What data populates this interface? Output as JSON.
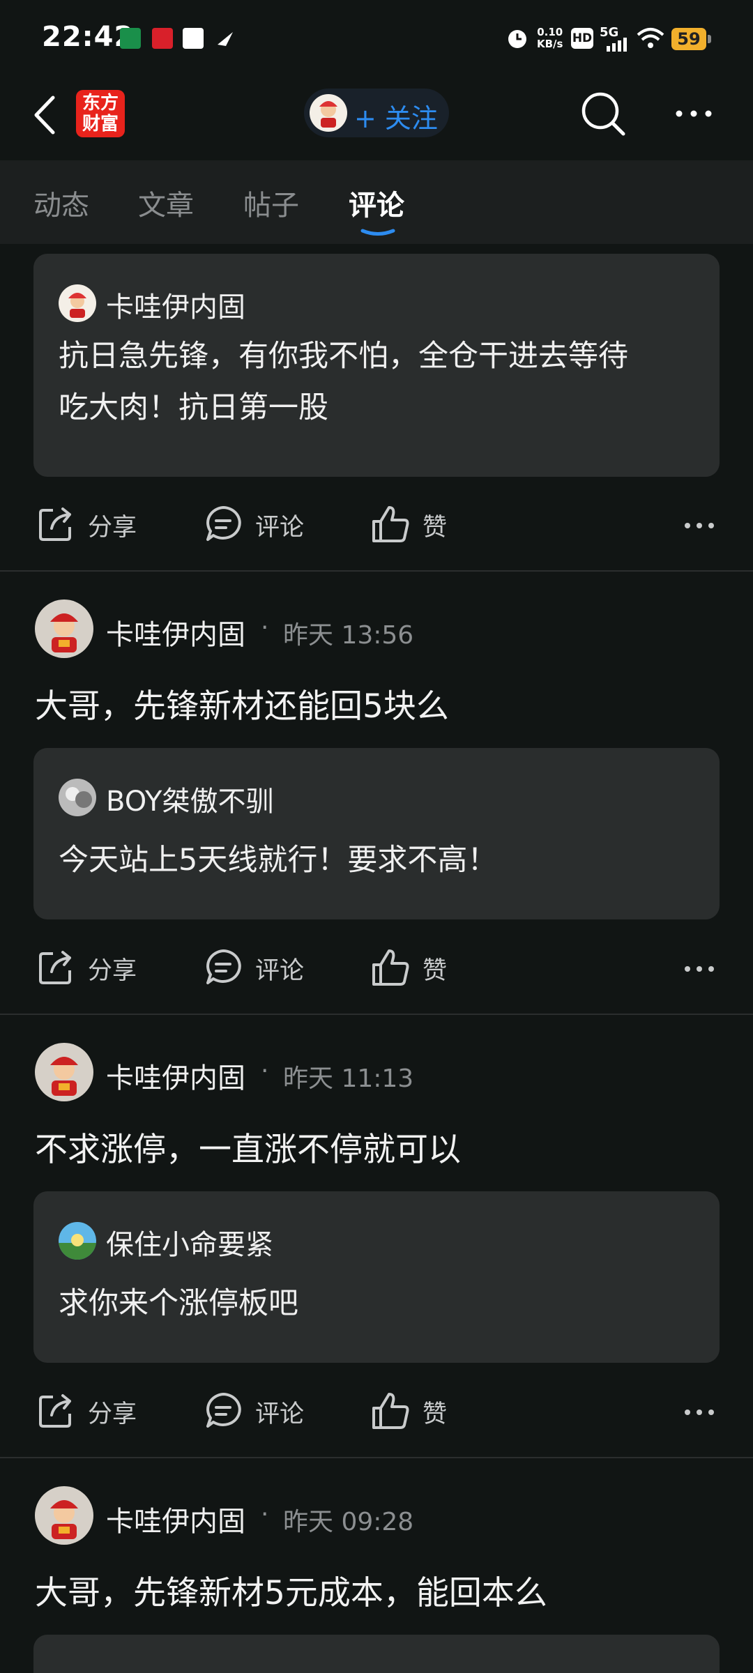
{
  "status_bar": {
    "time": "22:42",
    "net_speed_value": "0.10",
    "net_speed_unit": "KB/s",
    "hd": "HD",
    "network": "5G",
    "battery": "59"
  },
  "header": {
    "logo_line1": "东方",
    "logo_line2": "财富",
    "follow_label": "+ 关注"
  },
  "tabs": [
    {
      "label": "动态"
    },
    {
      "label": "文章"
    },
    {
      "label": "帖子"
    },
    {
      "label": "评论",
      "active": true
    }
  ],
  "actions": {
    "share": "分享",
    "comment": "评论",
    "like": "赞"
  },
  "posts": [
    {
      "quote": {
        "name": "卡哇伊内固",
        "text_line1": "抗日急先锋，有你我不怕，全仓干进去等待",
        "text_line2": "吃大肉！抗日第一股"
      }
    },
    {
      "author": "卡哇伊内固",
      "sep": "·",
      "time": "昨天 13:56",
      "text": "大哥，先锋新材还能回5块么",
      "quote": {
        "name": "BOY桀傲不驯",
        "text": "今天站上5天线就行！要求不高！"
      }
    },
    {
      "author": "卡哇伊内固",
      "sep": "·",
      "time": "昨天 11:13",
      "text": "不求涨停，一直涨不停就可以",
      "quote": {
        "name": "保住小命要紧",
        "text": "求你来个涨停板吧"
      }
    },
    {
      "author": "卡哇伊内固",
      "sep": "·",
      "time": "昨天 09:28",
      "text": "大哥，先锋新材5元成本，能回本么"
    }
  ],
  "colors": {
    "accent": "#2d8cf0",
    "background": "#111514",
    "card": "#2a2d2d",
    "brand_red": "#e8231c",
    "battery": "#f2b02c"
  }
}
